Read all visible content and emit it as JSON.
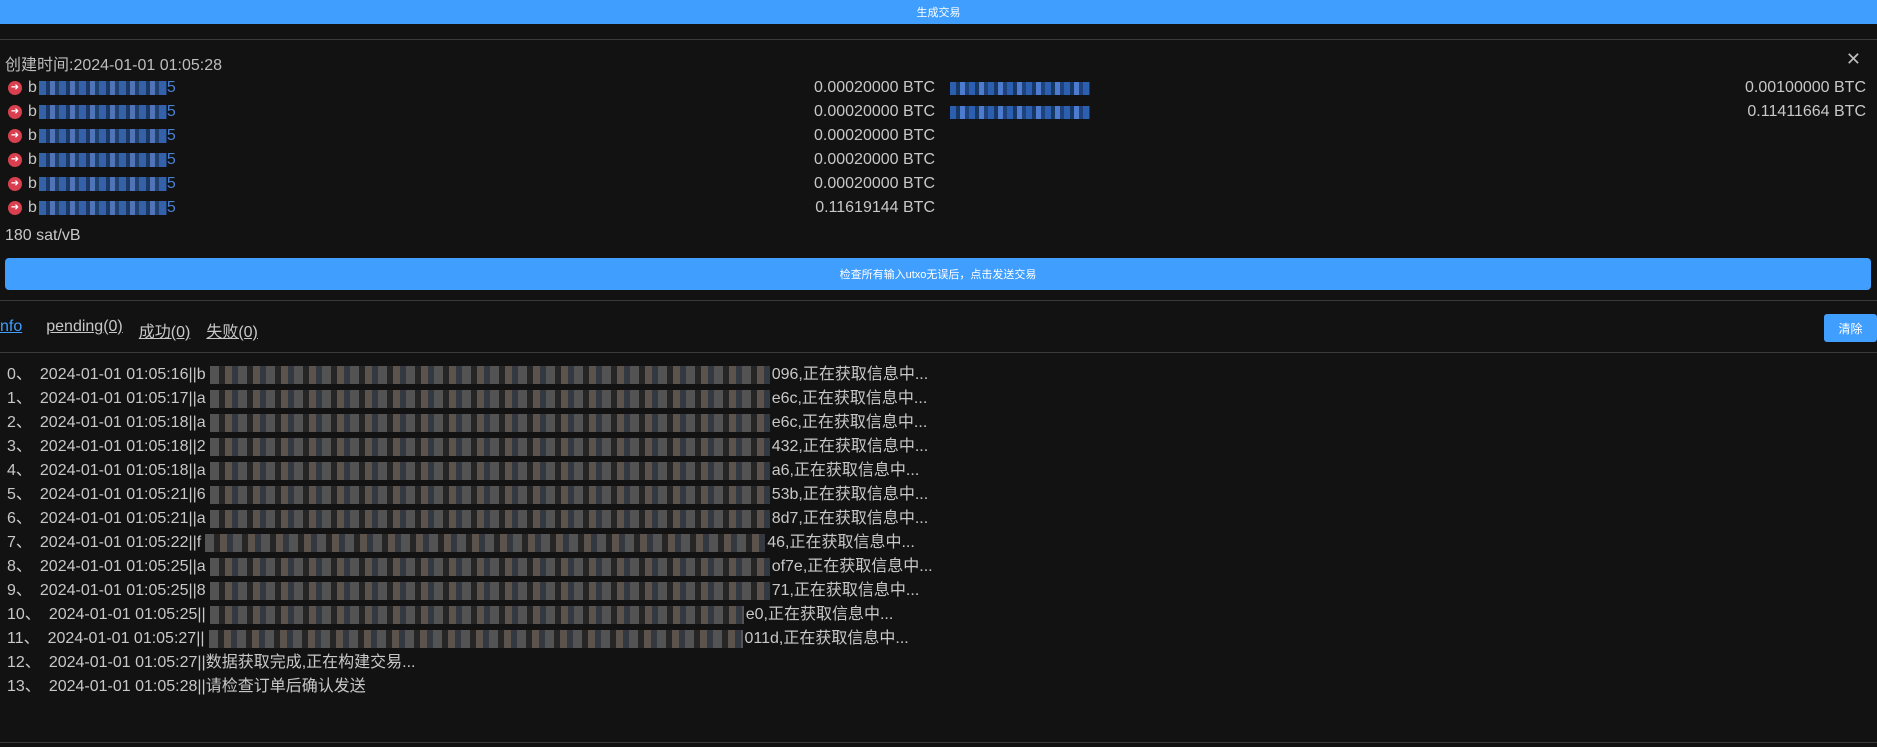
{
  "top_bar": {
    "label": "生成交易"
  },
  "panel": {
    "created_label": "创建时间:2024-01-01 01:05:28",
    "inputs": [
      {
        "prefix": "b",
        "suffix": "5",
        "amount": "0.00020000 BTC"
      },
      {
        "prefix": "b",
        "suffix": "5",
        "amount": "0.00020000 BTC"
      },
      {
        "prefix": "b",
        "suffix": "5",
        "amount": "0.00020000 BTC"
      },
      {
        "prefix": "b",
        "suffix": "5",
        "amount": "0.00020000 BTC"
      },
      {
        "prefix": "b",
        "suffix": "5",
        "amount": "0.00020000 BTC"
      },
      {
        "prefix": "b",
        "suffix": "5",
        "amount": "0.11619144 BTC"
      }
    ],
    "outputs": [
      {
        "amount": "0.00100000 BTC"
      },
      {
        "amount": "0.11411664 BTC"
      }
    ],
    "fee_rate": "180 sat/vB",
    "send_button_label": "检查所有输入utxo无误后，点击发送交易"
  },
  "tabs": [
    {
      "label": "nfo",
      "active": true
    },
    {
      "label": "pending(0)",
      "active": false
    },
    {
      "label": "成功(0)",
      "active": false
    },
    {
      "label": "失败(0)",
      "active": false
    }
  ],
  "clear_button_label": "清除",
  "log": [
    {
      "index": "0、",
      "time": "2024-01-01 01:05:16||b",
      "tail": "096,正在获取信息中..."
    },
    {
      "index": "1、",
      "time": "2024-01-01 01:05:17||a",
      "tail": "e6c,正在获取信息中..."
    },
    {
      "index": "2、",
      "time": "2024-01-01 01:05:18||a",
      "tail": "e6c,正在获取信息中..."
    },
    {
      "index": "3、",
      "time": "2024-01-01 01:05:18||2",
      "tail": "432,正在获取信息中..."
    },
    {
      "index": "4、",
      "time": "2024-01-01 01:05:18||a",
      "tail": "a6,正在获取信息中..."
    },
    {
      "index": "5、",
      "time": "2024-01-01 01:05:21||6",
      "tail": "53b,正在获取信息中..."
    },
    {
      "index": "6、",
      "time": "2024-01-01 01:05:21||a",
      "tail": "8d7,正在获取信息中..."
    },
    {
      "index": "7、",
      "time": "2024-01-01 01:05:22||f",
      "tail": "46,正在获取信息中..."
    },
    {
      "index": "8、",
      "time": "2024-01-01 01:05:25||a",
      "tail": "of7e,正在获取信息中..."
    },
    {
      "index": "9、",
      "time": "2024-01-01 01:05:25||8",
      "tail": "71,正在获取信息中..."
    },
    {
      "index": "10、",
      "time": "2024-01-01 01:05:25||",
      "tail": "e0,正在获取信息中..."
    },
    {
      "index": "11、",
      "time": "2024-01-01 01:05:27||",
      "tail": "011d,正在获取信息中..."
    },
    {
      "index": "12、",
      "time": "2024-01-01 01:05:27||数据获取完成,正在构建交易...",
      "tail": ""
    },
    {
      "index": "13、",
      "time": "2024-01-01 01:05:28||请检查订单后确认发送",
      "tail": ""
    }
  ]
}
